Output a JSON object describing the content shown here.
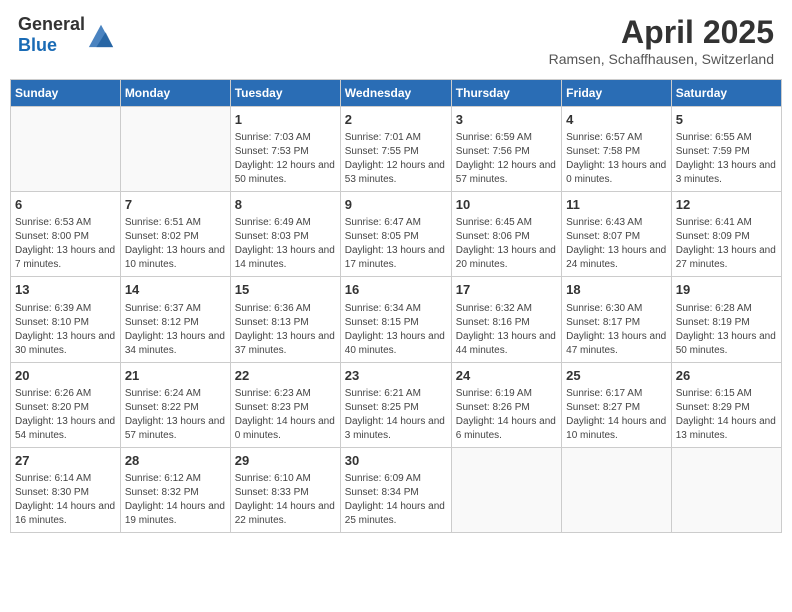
{
  "header": {
    "logo_general": "General",
    "logo_blue": "Blue",
    "month": "April 2025",
    "location": "Ramsen, Schaffhausen, Switzerland"
  },
  "days_of_week": [
    "Sunday",
    "Monday",
    "Tuesday",
    "Wednesday",
    "Thursday",
    "Friday",
    "Saturday"
  ],
  "weeks": [
    [
      {
        "day": "",
        "info": ""
      },
      {
        "day": "",
        "info": ""
      },
      {
        "day": "1",
        "info": "Sunrise: 7:03 AM\nSunset: 7:53 PM\nDaylight: 12 hours and 50 minutes."
      },
      {
        "day": "2",
        "info": "Sunrise: 7:01 AM\nSunset: 7:55 PM\nDaylight: 12 hours and 53 minutes."
      },
      {
        "day": "3",
        "info": "Sunrise: 6:59 AM\nSunset: 7:56 PM\nDaylight: 12 hours and 57 minutes."
      },
      {
        "day": "4",
        "info": "Sunrise: 6:57 AM\nSunset: 7:58 PM\nDaylight: 13 hours and 0 minutes."
      },
      {
        "day": "5",
        "info": "Sunrise: 6:55 AM\nSunset: 7:59 PM\nDaylight: 13 hours and 3 minutes."
      }
    ],
    [
      {
        "day": "6",
        "info": "Sunrise: 6:53 AM\nSunset: 8:00 PM\nDaylight: 13 hours and 7 minutes."
      },
      {
        "day": "7",
        "info": "Sunrise: 6:51 AM\nSunset: 8:02 PM\nDaylight: 13 hours and 10 minutes."
      },
      {
        "day": "8",
        "info": "Sunrise: 6:49 AM\nSunset: 8:03 PM\nDaylight: 13 hours and 14 minutes."
      },
      {
        "day": "9",
        "info": "Sunrise: 6:47 AM\nSunset: 8:05 PM\nDaylight: 13 hours and 17 minutes."
      },
      {
        "day": "10",
        "info": "Sunrise: 6:45 AM\nSunset: 8:06 PM\nDaylight: 13 hours and 20 minutes."
      },
      {
        "day": "11",
        "info": "Sunrise: 6:43 AM\nSunset: 8:07 PM\nDaylight: 13 hours and 24 minutes."
      },
      {
        "day": "12",
        "info": "Sunrise: 6:41 AM\nSunset: 8:09 PM\nDaylight: 13 hours and 27 minutes."
      }
    ],
    [
      {
        "day": "13",
        "info": "Sunrise: 6:39 AM\nSunset: 8:10 PM\nDaylight: 13 hours and 30 minutes."
      },
      {
        "day": "14",
        "info": "Sunrise: 6:37 AM\nSunset: 8:12 PM\nDaylight: 13 hours and 34 minutes."
      },
      {
        "day": "15",
        "info": "Sunrise: 6:36 AM\nSunset: 8:13 PM\nDaylight: 13 hours and 37 minutes."
      },
      {
        "day": "16",
        "info": "Sunrise: 6:34 AM\nSunset: 8:15 PM\nDaylight: 13 hours and 40 minutes."
      },
      {
        "day": "17",
        "info": "Sunrise: 6:32 AM\nSunset: 8:16 PM\nDaylight: 13 hours and 44 minutes."
      },
      {
        "day": "18",
        "info": "Sunrise: 6:30 AM\nSunset: 8:17 PM\nDaylight: 13 hours and 47 minutes."
      },
      {
        "day": "19",
        "info": "Sunrise: 6:28 AM\nSunset: 8:19 PM\nDaylight: 13 hours and 50 minutes."
      }
    ],
    [
      {
        "day": "20",
        "info": "Sunrise: 6:26 AM\nSunset: 8:20 PM\nDaylight: 13 hours and 54 minutes."
      },
      {
        "day": "21",
        "info": "Sunrise: 6:24 AM\nSunset: 8:22 PM\nDaylight: 13 hours and 57 minutes."
      },
      {
        "day": "22",
        "info": "Sunrise: 6:23 AM\nSunset: 8:23 PM\nDaylight: 14 hours and 0 minutes."
      },
      {
        "day": "23",
        "info": "Sunrise: 6:21 AM\nSunset: 8:25 PM\nDaylight: 14 hours and 3 minutes."
      },
      {
        "day": "24",
        "info": "Sunrise: 6:19 AM\nSunset: 8:26 PM\nDaylight: 14 hours and 6 minutes."
      },
      {
        "day": "25",
        "info": "Sunrise: 6:17 AM\nSunset: 8:27 PM\nDaylight: 14 hours and 10 minutes."
      },
      {
        "day": "26",
        "info": "Sunrise: 6:15 AM\nSunset: 8:29 PM\nDaylight: 14 hours and 13 minutes."
      }
    ],
    [
      {
        "day": "27",
        "info": "Sunrise: 6:14 AM\nSunset: 8:30 PM\nDaylight: 14 hours and 16 minutes."
      },
      {
        "day": "28",
        "info": "Sunrise: 6:12 AM\nSunset: 8:32 PM\nDaylight: 14 hours and 19 minutes."
      },
      {
        "day": "29",
        "info": "Sunrise: 6:10 AM\nSunset: 8:33 PM\nDaylight: 14 hours and 22 minutes."
      },
      {
        "day": "30",
        "info": "Sunrise: 6:09 AM\nSunset: 8:34 PM\nDaylight: 14 hours and 25 minutes."
      },
      {
        "day": "",
        "info": ""
      },
      {
        "day": "",
        "info": ""
      },
      {
        "day": "",
        "info": ""
      }
    ]
  ]
}
